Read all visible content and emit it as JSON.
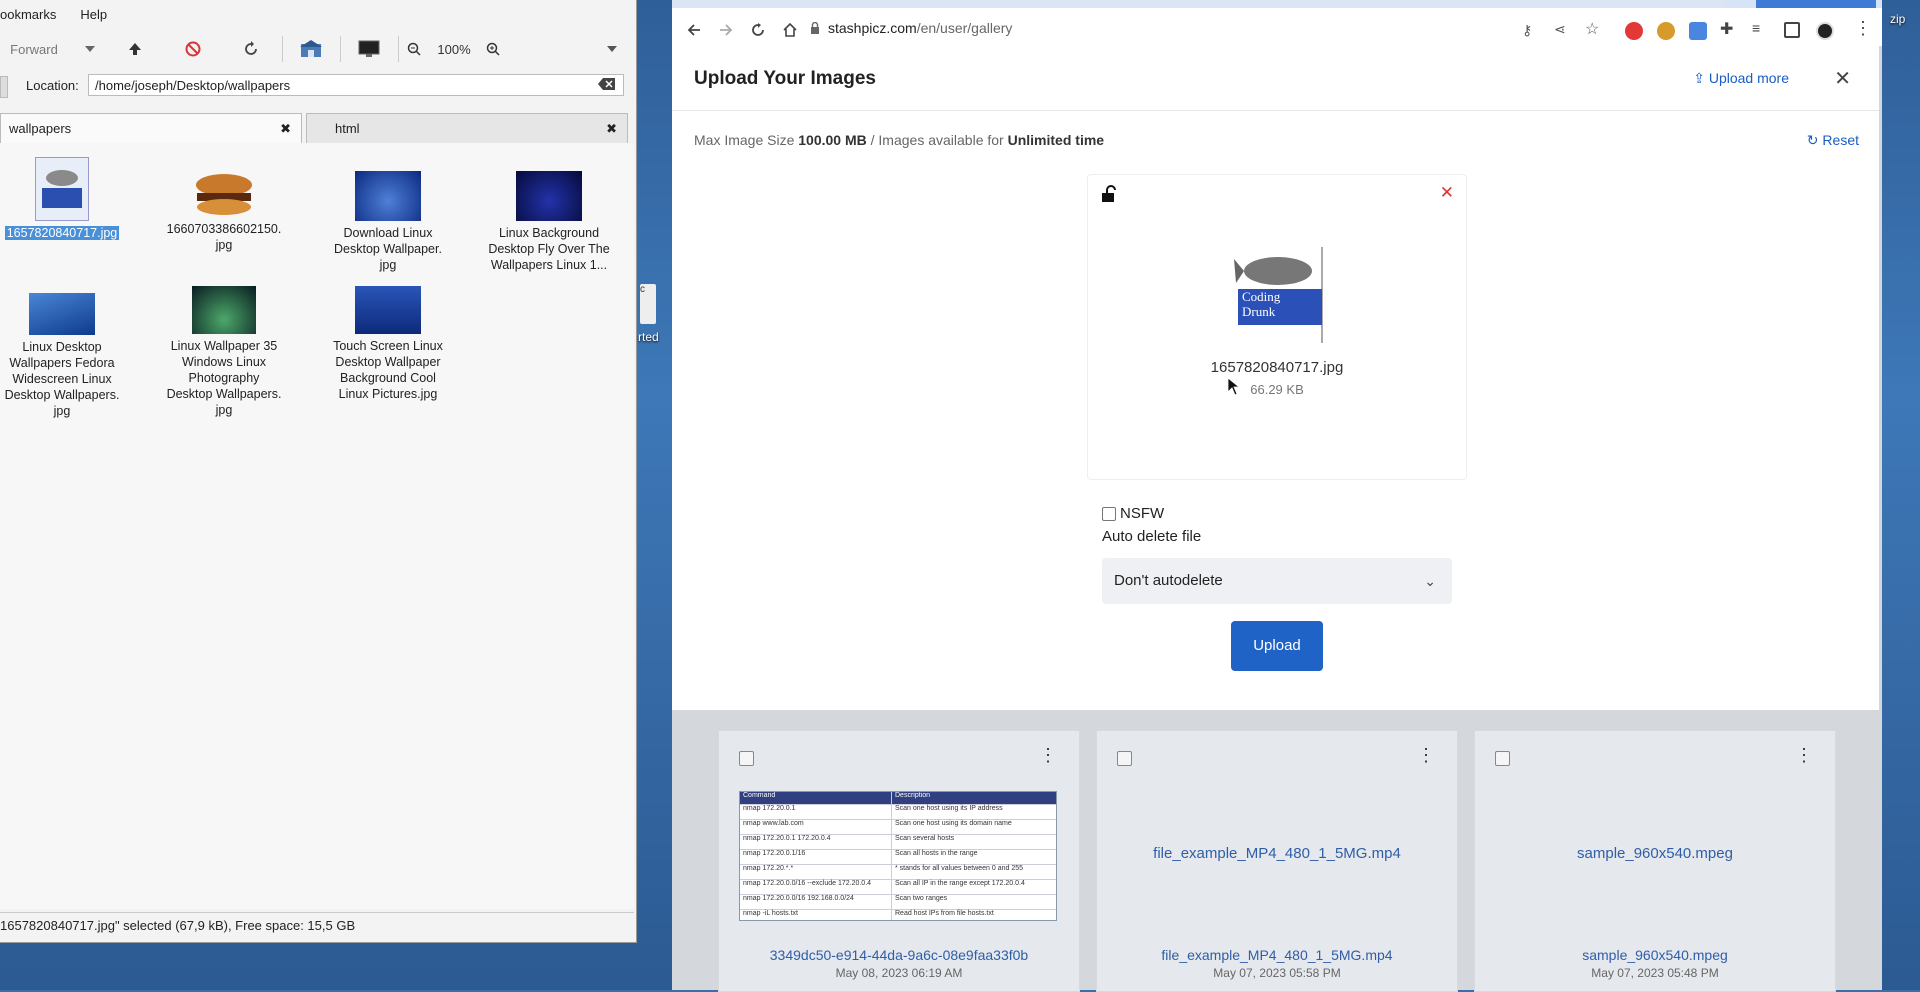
{
  "file_manager": {
    "menu": [
      "ookmarks",
      "Help"
    ],
    "toolbar": {
      "forward_label": "Forward",
      "zoom_level": "100%"
    },
    "location": {
      "label": "Location:",
      "path": "/home/joseph/Desktop/wallpapers"
    },
    "tabs": [
      {
        "label": "wallpapers"
      },
      {
        "label": "html"
      }
    ],
    "files": [
      {
        "name": "1657820840717.jpg",
        "selected": true
      },
      {
        "name": "1660703386602150.\njpg"
      },
      {
        "name": "Download Linux\nDesktop Wallpaper.\njpg"
      },
      {
        "name": "Linux Background\nDesktop Fly Over The\nWallpapers Linux  1..."
      },
      {
        "name": "Linux Desktop\nWallpapers Fedora\nWidescreen Linux\nDesktop Wallpapers.\njpg"
      },
      {
        "name": "Linux Wallpaper 35\nWindows Linux\nPhotography\nDesktop Wallpapers.\njpg"
      },
      {
        "name": "Touch Screen Linux\nDesktop Wallpaper\nBackground Cool\nLinux Pictures.jpg"
      }
    ],
    "status": "1657820840717.jpg\" selected (67,9 kB), Free space: 15,5 GB"
  },
  "desktop": {
    "partial_icon_text": "rted",
    "partial_zip_text": "zip"
  },
  "browser": {
    "url_domain": "stashpicz.com",
    "url_path": "/en/user/gallery",
    "modal": {
      "title": "Upload Your Images",
      "upload_more": "Upload more",
      "info_prefix": "Max Image Size",
      "max_size": "100.00 MB",
      "info_mid": "/ Images available for",
      "duration": "Unlimited time",
      "reset": "Reset",
      "preview": {
        "filename": "1657820840717.jpg",
        "size": "66.29 KB",
        "image_text_1": "Coding",
        "image_text_2": "Drunk"
      },
      "nsfw_label": "NSFW",
      "auto_delete_label": "Auto delete file",
      "auto_delete_value": "Don't autodelete",
      "upload_button": "Upload"
    },
    "gallery": [
      {
        "name": "3349dc50-e914-44da-9a6c-08e9faa33f0b",
        "date": "May 08, 2023 06:19 AM",
        "alt": ""
      },
      {
        "name": "file_example_MP4_480_1_5MG.mp4",
        "date": "May 07, 2023 05:58 PM",
        "alt": "file_example_MP4_480_1_5MG.mp4"
      },
      {
        "name": "sample_960x540.mpeg",
        "date": "May 07, 2023 05:48 PM",
        "alt": "sample_960x540.mpeg"
      }
    ],
    "cheatsheet": {
      "headers": [
        "Command",
        "Description"
      ],
      "rows": [
        [
          "nmap 172.20.0.1",
          "Scan one host using its IP address"
        ],
        [
          "nmap www.lab.com",
          "Scan one host using its domain name"
        ],
        [
          "nmap 172.20.0.1 172.20.0.4",
          "Scan several hosts"
        ],
        [
          "nmap 172.20.0.1/16",
          "Scan all hosts in the range"
        ],
        [
          "nmap 172.20.*.*",
          "* stands for all values between 0 and 255"
        ],
        [
          "nmap 172.20.0.0/16 --exclude 172.20.0.4",
          "Scan all IP in the range except 172.20.0.4"
        ],
        [
          "nmap 172.20.0.0/16 192.168.0.0/24",
          "Scan two ranges"
        ],
        [
          "nmap -iL hosts.txt",
          "Read host IPs from file hosts.txt"
        ]
      ]
    }
  }
}
